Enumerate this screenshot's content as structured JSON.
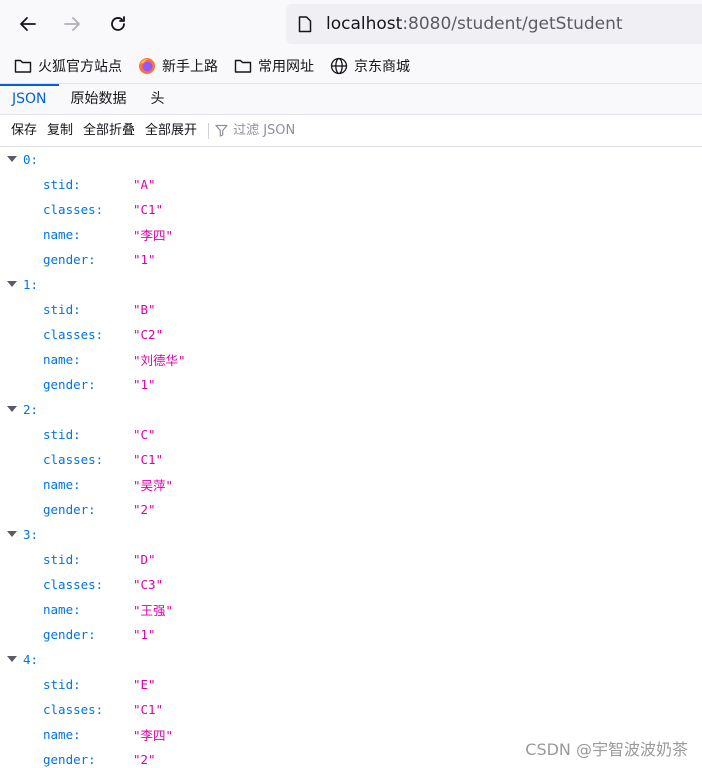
{
  "browser": {
    "url_host": "localhost",
    "url_rest": ":8080/student/getStudent"
  },
  "bookmarks": [
    {
      "label": "火狐官方站点",
      "icon": "folder-icon"
    },
    {
      "label": "新手上路",
      "icon": "firefox-icon"
    },
    {
      "label": "常用网址",
      "icon": "folder-icon"
    },
    {
      "label": "京东商城",
      "icon": "globe-icon"
    }
  ],
  "tabs": [
    {
      "label": "JSON",
      "active": true
    },
    {
      "label": "原始数据",
      "active": false
    },
    {
      "label": "头",
      "active": false
    }
  ],
  "toolbar": {
    "save": "保存",
    "copy": "复制",
    "collapse_all": "全部折叠",
    "expand_all": "全部展开",
    "filter_placeholder": "过滤 JSON"
  },
  "records": [
    {
      "index": "0:",
      "fields": [
        {
          "key": "stid:",
          "value": "\"A\""
        },
        {
          "key": "classes:",
          "value": "\"C1\""
        },
        {
          "key": "name:",
          "value": "\"李四\""
        },
        {
          "key": "gender:",
          "value": "\"1\""
        }
      ]
    },
    {
      "index": "1:",
      "fields": [
        {
          "key": "stid:",
          "value": "\"B\""
        },
        {
          "key": "classes:",
          "value": "\"C2\""
        },
        {
          "key": "name:",
          "value": "\"刘德华\""
        },
        {
          "key": "gender:",
          "value": "\"1\""
        }
      ]
    },
    {
      "index": "2:",
      "fields": [
        {
          "key": "stid:",
          "value": "\"C\""
        },
        {
          "key": "classes:",
          "value": "\"C1\""
        },
        {
          "key": "name:",
          "value": "\"吴萍\""
        },
        {
          "key": "gender:",
          "value": "\"2\""
        }
      ]
    },
    {
      "index": "3:",
      "fields": [
        {
          "key": "stid:",
          "value": "\"D\""
        },
        {
          "key": "classes:",
          "value": "\"C3\""
        },
        {
          "key": "name:",
          "value": "\"王强\""
        },
        {
          "key": "gender:",
          "value": "\"1\""
        }
      ]
    },
    {
      "index": "4:",
      "fields": [
        {
          "key": "stid:",
          "value": "\"E\""
        },
        {
          "key": "classes:",
          "value": "\"C1\""
        },
        {
          "key": "name:",
          "value": "\"李四\""
        },
        {
          "key": "gender:",
          "value": "\"2\""
        }
      ]
    }
  ],
  "watermark": "CSDN @宇智波波奶茶",
  "colors": {
    "accent": "#0060df",
    "json_key": "#0074e8",
    "json_string": "#dd00a9"
  }
}
